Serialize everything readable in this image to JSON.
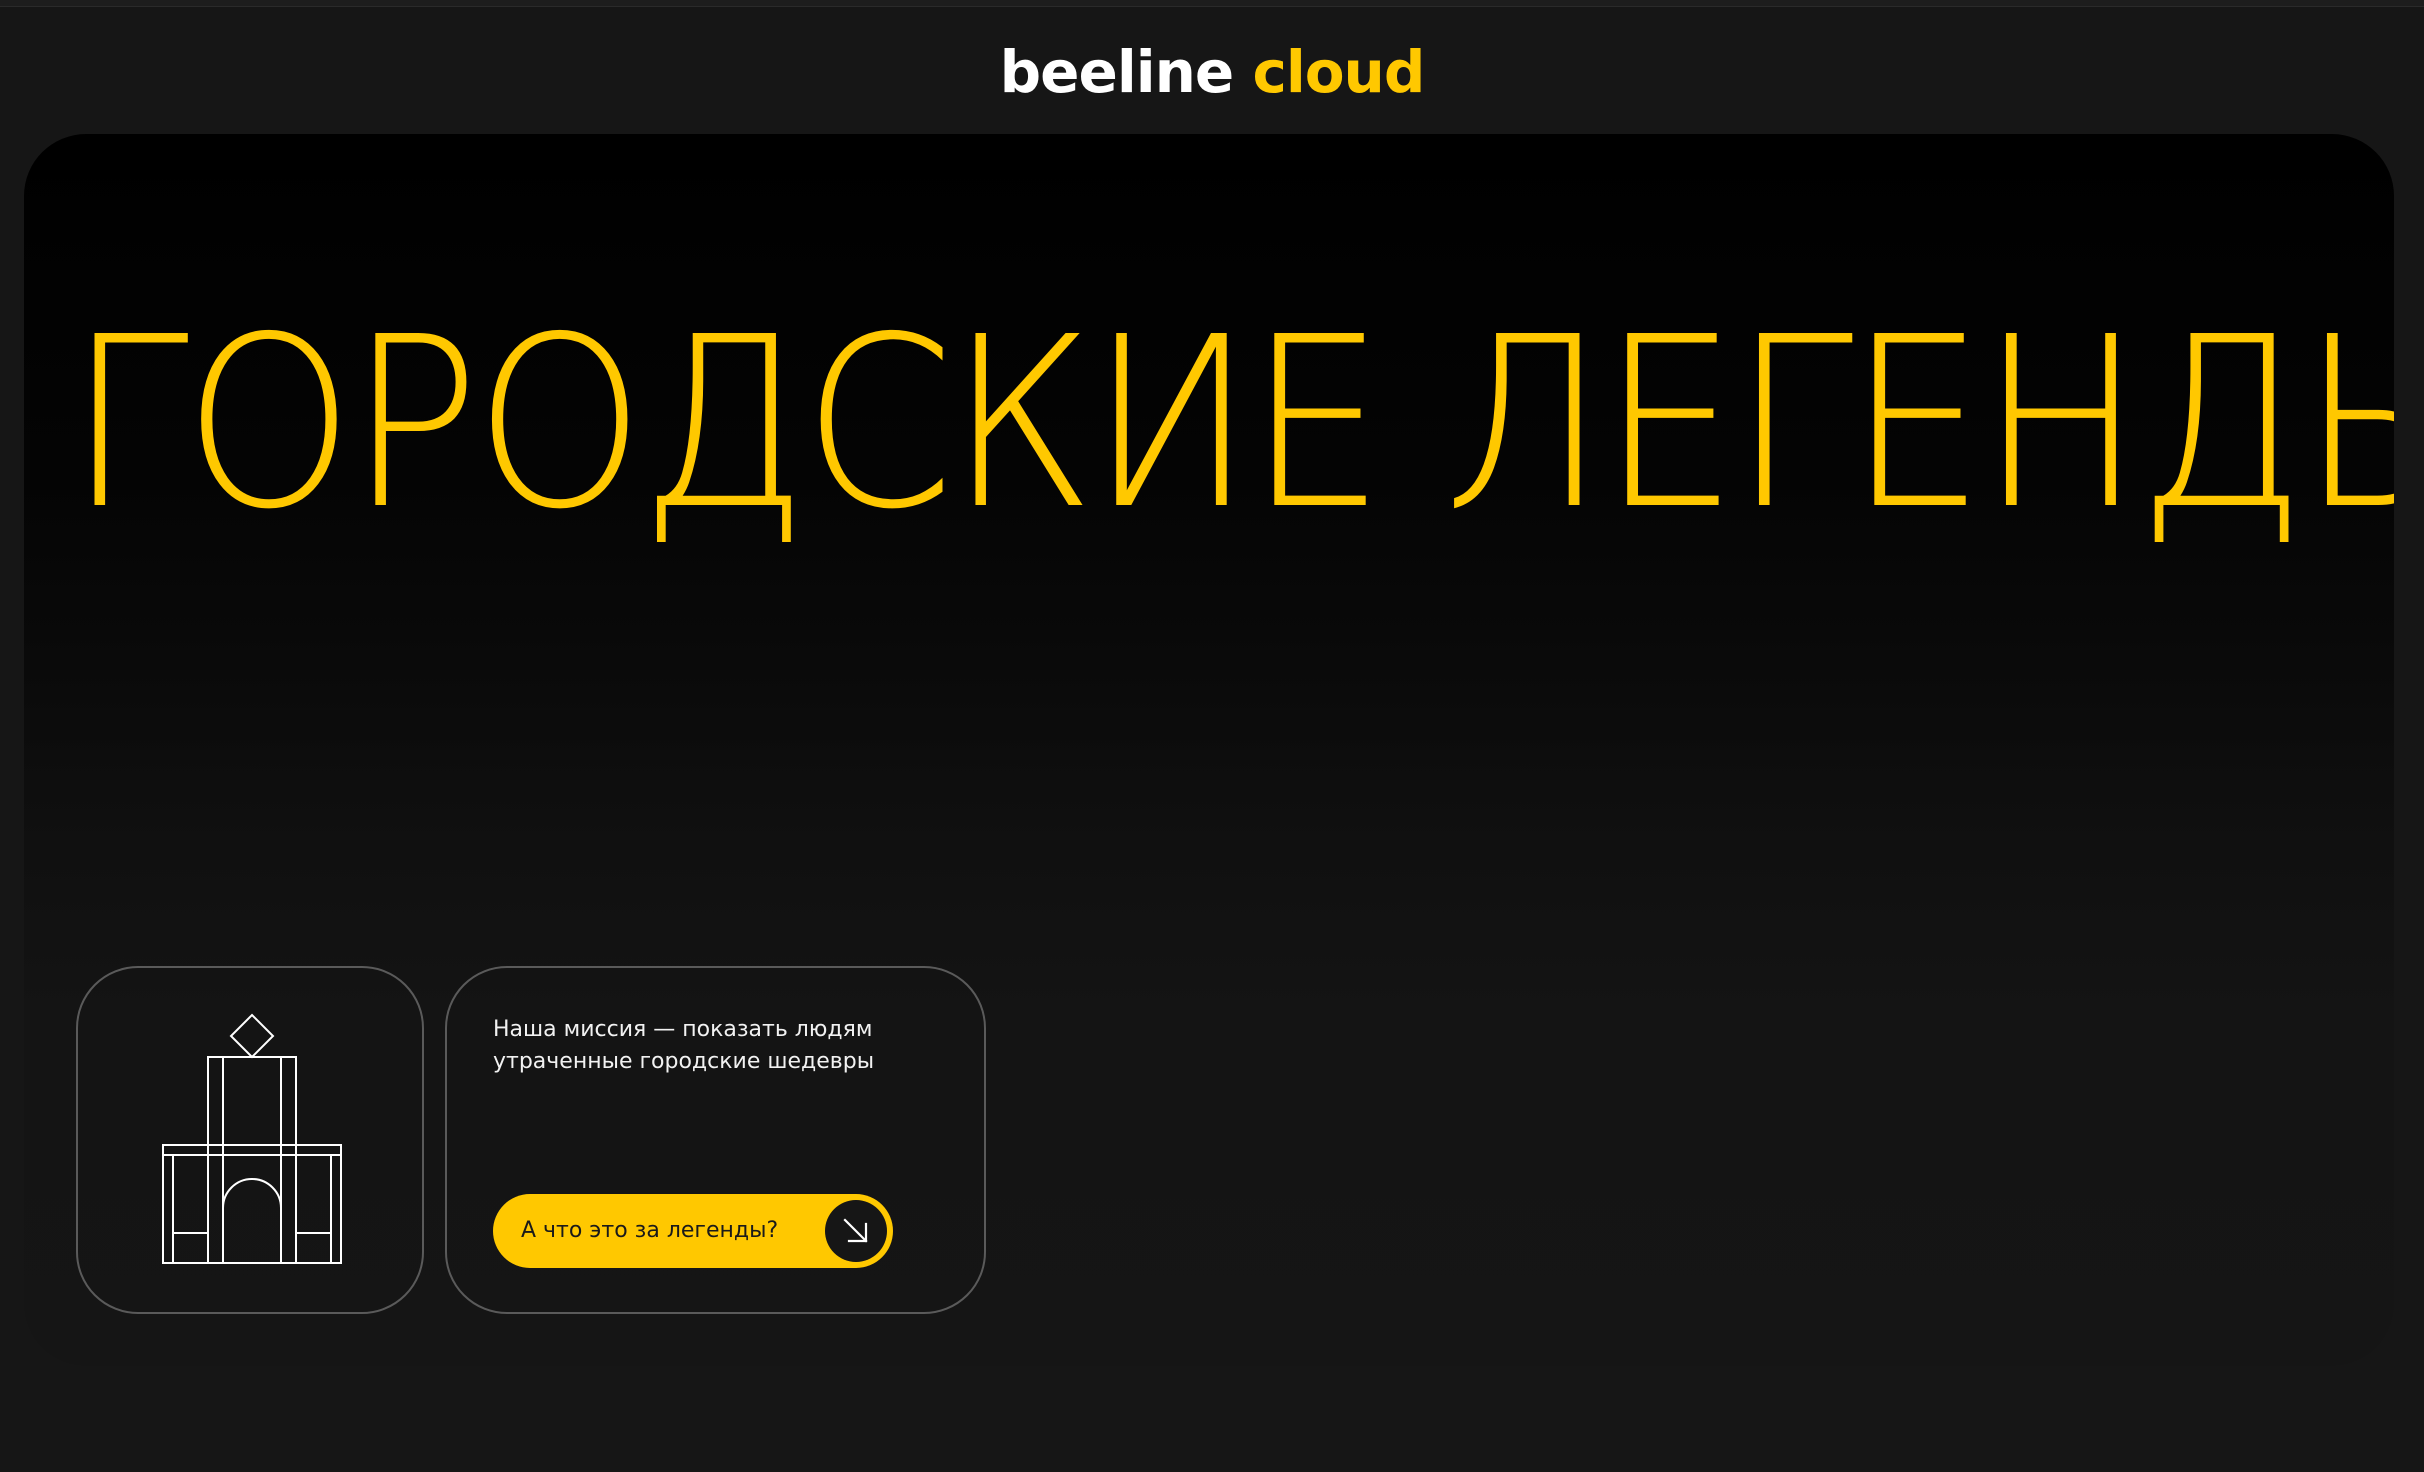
{
  "brand": {
    "word1": "beeline",
    "word2": "cloud",
    "accent_color": "#ffc800"
  },
  "hero": {
    "title": "ГОРОДСКИЕ ЛЕГЕНДЫ"
  },
  "illustration": {
    "icon": "triumphal-arch-icon"
  },
  "mission": {
    "line1": "Наша миссия — показать людям",
    "line2": "утраченные городские шедевры"
  },
  "cta": {
    "label": "А что это за легенды?",
    "icon": "arrow-down-right-icon"
  },
  "colors": {
    "background": "#161616",
    "accent": "#ffc800",
    "text": "#ffffff"
  }
}
